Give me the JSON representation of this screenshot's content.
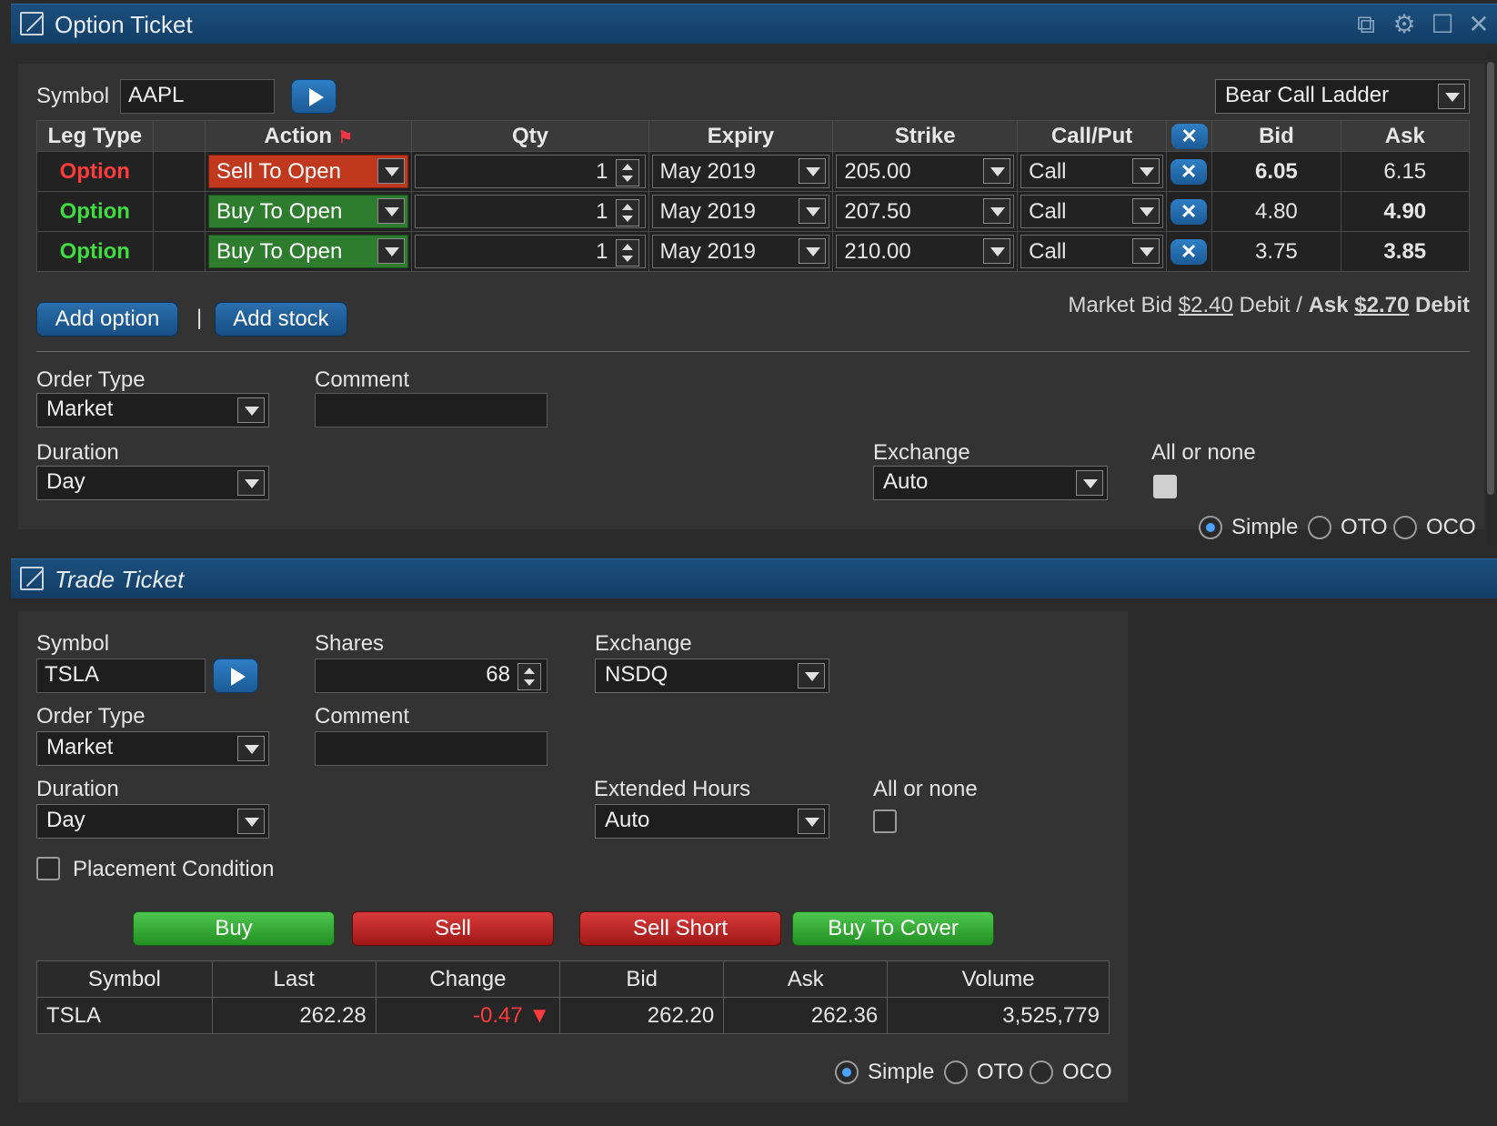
{
  "option_ticket": {
    "title": "Option Ticket",
    "symbol_label": "Symbol",
    "symbol_value": "AAPL",
    "strategy": "Bear Call Ladder",
    "columns": [
      "Leg Type",
      "Action",
      "Qty",
      "Expiry",
      "Strike",
      "Call/Put",
      "Bid",
      "Ask"
    ],
    "legs": [
      {
        "leg_type": "Option",
        "action": "Sell To Open",
        "qty": "1",
        "expiry": "May 2019",
        "strike": "205.00",
        "callput": "Call",
        "bid": "6.05",
        "ask": "6.15"
      },
      {
        "leg_type": "Option",
        "action": "Buy To Open",
        "qty": "1",
        "expiry": "May 2019",
        "strike": "207.50",
        "callput": "Call",
        "bid": "4.80",
        "ask": "4.90"
      },
      {
        "leg_type": "Option",
        "action": "Buy To Open",
        "qty": "1",
        "expiry": "May 2019",
        "strike": "210.00",
        "callput": "Call",
        "bid": "3.75",
        "ask": "3.85"
      }
    ],
    "add_option": "Add option",
    "separator": "|",
    "add_stock": "Add stock",
    "market_text_1": "Market Bid ",
    "market_bid": "$2.40",
    "market_text_2": " Debit / ",
    "market_ask_label": "Ask ",
    "market_ask": "$2.70",
    "market_text_3": " Debit",
    "order_type_label": "Order Type",
    "order_type": "Market",
    "comment_label": "Comment",
    "duration_label": "Duration",
    "duration": "Day",
    "exchange_label": "Exchange",
    "exchange": "Auto",
    "all_or_none_label": "All or none",
    "radios": [
      "Simple",
      "OTO",
      "OCO"
    ]
  },
  "trade_ticket": {
    "title": "Trade Ticket",
    "symbol_label": "Symbol",
    "symbol_value": "TSLA",
    "shares_label": "Shares",
    "shares_value": "68",
    "exchange_label": "Exchange",
    "exchange": "NSDQ",
    "order_type_label": "Order Type",
    "order_type": "Market",
    "comment_label": "Comment",
    "duration_label": "Duration",
    "duration": "Day",
    "extended_label": "Extended Hours",
    "extended": "Auto",
    "all_or_none_label": "All or none",
    "placement_label": "Placement Condition",
    "buttons": {
      "buy": "Buy",
      "sell": "Sell",
      "sell_short": "Sell Short",
      "buy_to_cover": "Buy To Cover"
    },
    "quote_columns": [
      "Symbol",
      "Last",
      "Change",
      "Bid",
      "Ask",
      "Volume"
    ],
    "quote": {
      "symbol": "TSLA",
      "last": "262.28",
      "change": "-0.47",
      "bid": "262.20",
      "ask": "262.36",
      "volume": "3,525,779"
    },
    "radios": [
      "Simple",
      "OTO",
      "OCO"
    ]
  },
  "colors": {
    "sell": "#c0391f",
    "buy": "#2e7d2e",
    "accent": "#1b5a96",
    "negative": "#ff3b3b"
  }
}
